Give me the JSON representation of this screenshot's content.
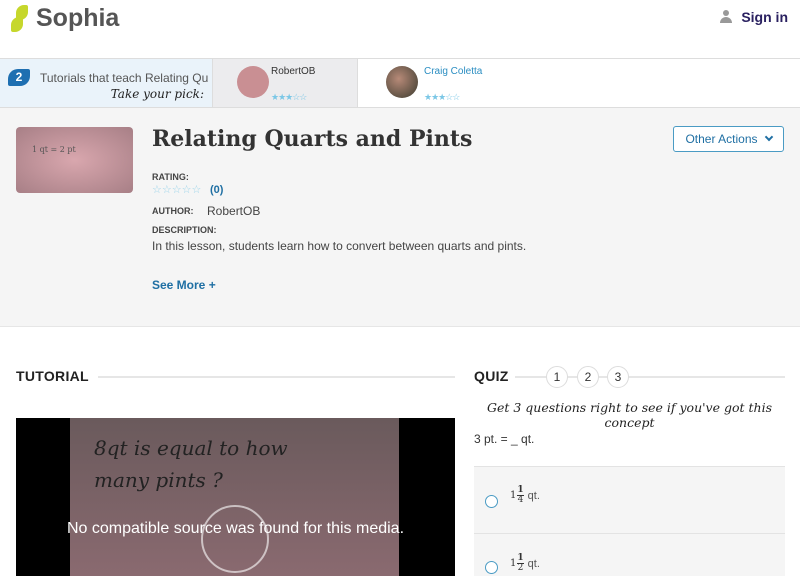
{
  "header": {
    "brand": "Sophia",
    "sign_in": "Sign in"
  },
  "strip": {
    "count": "2",
    "intro": "Tutorials that teach Relating Quarts and Pints",
    "pick": "Take your pick:",
    "tutorials": [
      {
        "author": "RobertOB",
        "stars": "★★★☆☆"
      },
      {
        "author": "Craig Coletta",
        "stars": "★★★☆☆"
      }
    ]
  },
  "details": {
    "thumb_text": "1 qt = 2 pt",
    "title": "Relating Quarts and Pints",
    "rating_label": "RATING:",
    "rating_stars": "☆☆☆☆☆",
    "rating_count": "(0)",
    "author_label": "AUTHOR:",
    "author": "RobertOB",
    "description_label": "DESCRIPTION:",
    "description": "In this lesson, students learn how to convert between quarts and pints.",
    "see_more": "See More +",
    "other_actions": "Other Actions"
  },
  "tutorial": {
    "heading": "TUTORIAL",
    "video_text_1": "8qt is equal to how",
    "video_text_2": "many pints ?",
    "error": "No compatible source was found for this media."
  },
  "quiz": {
    "heading": "QUIZ",
    "steps": [
      "1",
      "2",
      "3"
    ],
    "instructions": "Get 3 questions right to see if you've got this concept",
    "question": "3 pt. = _ qt.",
    "options": [
      {
        "whole": "1",
        "num": "1",
        "den": "4",
        "unit": "qt."
      },
      {
        "whole": "1",
        "num": "1",
        "den": "2",
        "unit": "qt."
      }
    ]
  }
}
